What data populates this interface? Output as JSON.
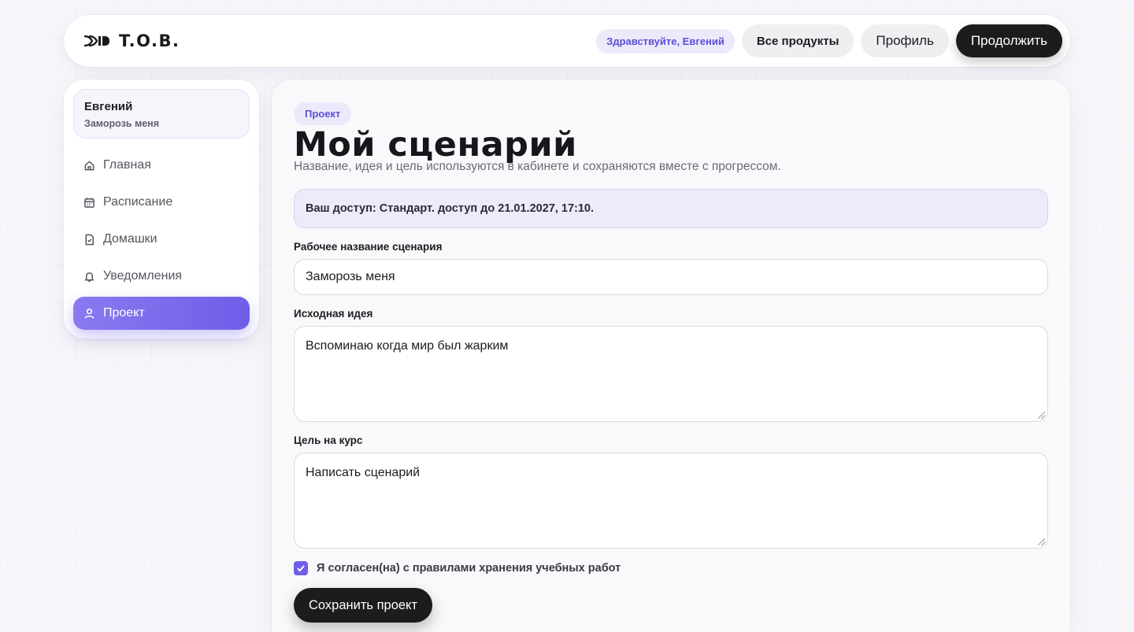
{
  "header": {
    "logo_text": "T.O.B.",
    "greeting": "Здравствуйте, Евгений",
    "all_products": "Все продукты",
    "profile": "Профиль",
    "continue": "Продолжить"
  },
  "sidebar": {
    "user_name": "Евгений",
    "user_project": "Заморозь меня",
    "items": [
      {
        "label": "Главная",
        "icon": "home-icon"
      },
      {
        "label": "Расписание",
        "icon": "calendar-icon"
      },
      {
        "label": "Домашки",
        "icon": "document-icon"
      },
      {
        "label": "Уведомления",
        "icon": "bell-icon"
      },
      {
        "label": "Проект",
        "icon": "user-icon",
        "active": true
      }
    ]
  },
  "main": {
    "tag": "Проект",
    "title": "Мой сценарий",
    "subtitle": "Название, идея и цель используются в кабинете и сохраняются вместе с прогрессом.",
    "access_notice": "Ваш доступ: Стандарт. доступ до 21.01.2027, 17:10.",
    "fields": {
      "name_label": "Рабочее название сценария",
      "name_value": "Заморозь меня",
      "idea_label": "Исходная идея",
      "idea_value": "Вспоминаю когда мир был жарким",
      "goal_label": "Цель на курс",
      "goal_value": "Написать сценарий"
    },
    "consent_label": "Я согласен(на) с правилами хранения учебных работ",
    "consent_checked": true,
    "save_label": "Сохранить проект"
  },
  "colors": {
    "accent": "#6e5ee8",
    "accent_soft": "#ece9fb",
    "dark_button": "#1c1c1f"
  }
}
